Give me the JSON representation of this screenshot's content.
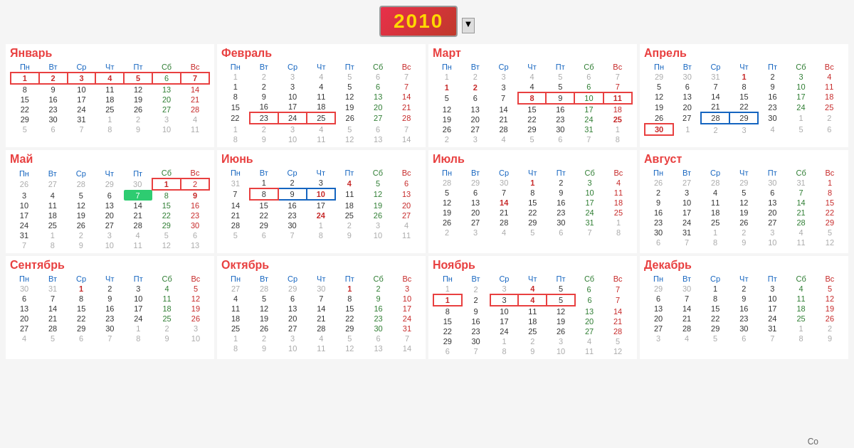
{
  "header": {
    "year": "2010",
    "year_label": "2010"
  },
  "months": [
    {
      "name": "Январь",
      "row": 0,
      "col": 0
    },
    {
      "name": "Февраль",
      "row": 0,
      "col": 1
    },
    {
      "name": "Март",
      "row": 0,
      "col": 2
    },
    {
      "name": "Апрель",
      "row": 0,
      "col": 3
    },
    {
      "name": "Май",
      "row": 1,
      "col": 0
    },
    {
      "name": "Июнь",
      "row": 1,
      "col": 1
    },
    {
      "name": "Июль",
      "row": 1,
      "col": 2
    },
    {
      "name": "Август",
      "row": 1,
      "col": 3
    },
    {
      "name": "Сентябрь",
      "row": 2,
      "col": 0
    },
    {
      "name": "Октябрь",
      "row": 2,
      "col": 1
    },
    {
      "name": "Ноябрь",
      "row": 2,
      "col": 2
    },
    {
      "name": "Декабрь",
      "row": 2,
      "col": 3
    }
  ],
  "weekdays": [
    "Пн",
    "Вт",
    "Ср",
    "Чт",
    "Пт",
    "Сб",
    "Вс"
  ],
  "colors": {
    "month_title": "#e84040",
    "weekday": "#1565c0",
    "saturday": "#2e7d32",
    "sunday": "#c62828",
    "other_month": "#aaa",
    "today_bg": "#2ecc71"
  }
}
